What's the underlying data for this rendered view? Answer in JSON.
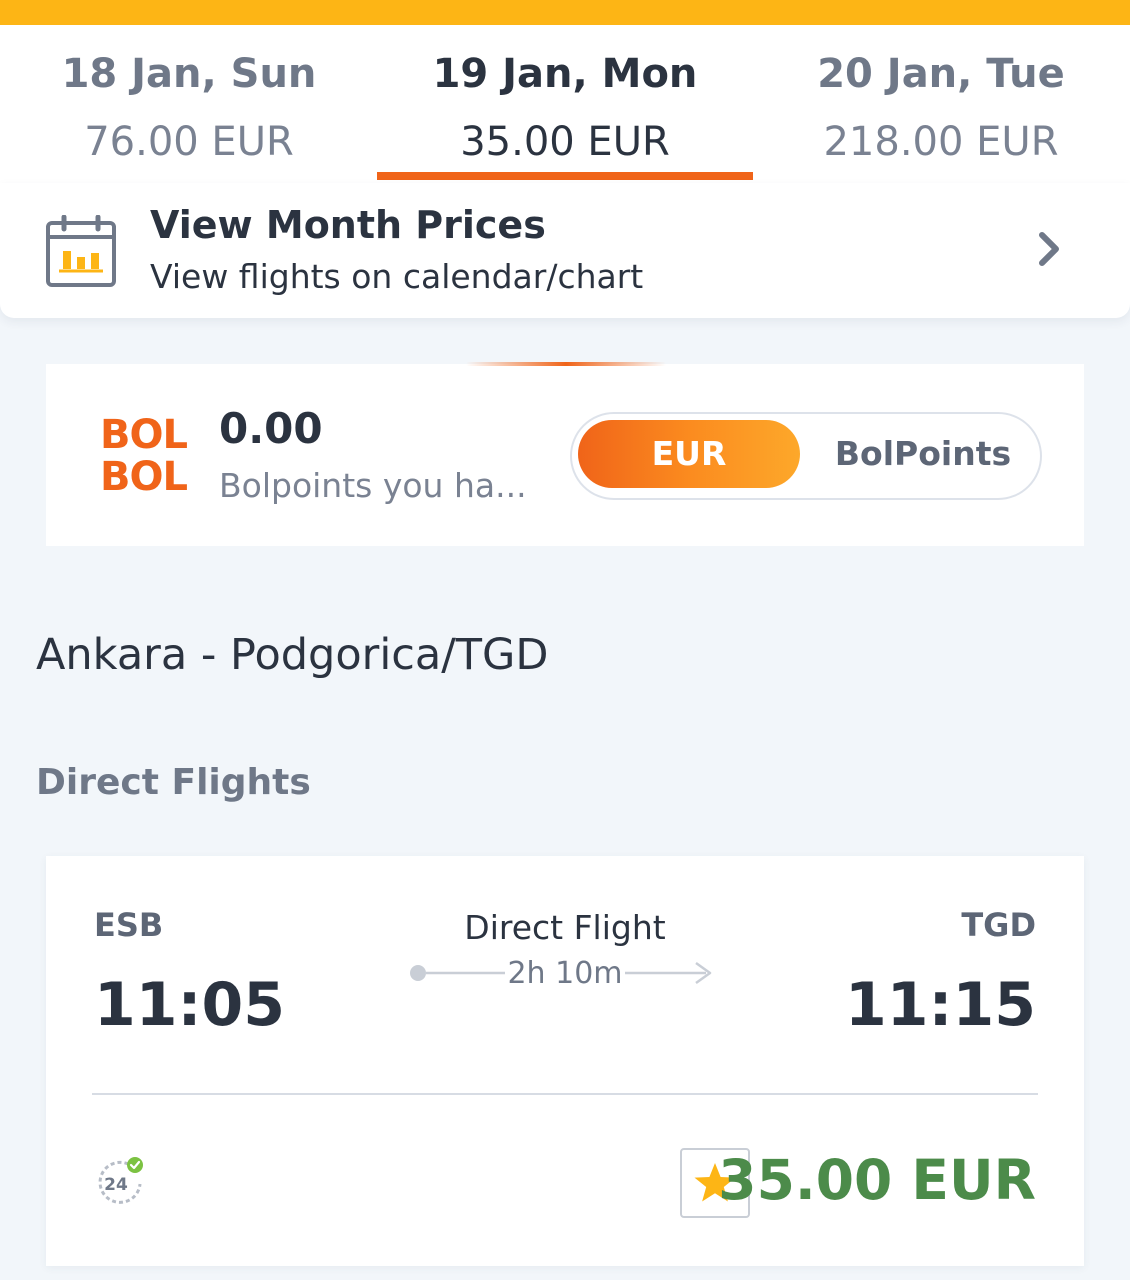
{
  "dates": [
    {
      "date": "18 Jan, Sun",
      "price": "76.00 EUR",
      "active": false
    },
    {
      "date": "19 Jan, Mon",
      "price": "35.00 EUR",
      "active": true
    },
    {
      "date": "20 Jan, Tue",
      "price": "218.00 EUR",
      "active": false
    }
  ],
  "month_prices": {
    "title": "View Month Prices",
    "subtitle": "View flights on calendar/chart",
    "icon": "calendar-chart-icon"
  },
  "bolpoints": {
    "logo_line1": "BOL",
    "logo_line2": "BOL",
    "value": "0.00",
    "subtitle": "Bolpoints you ha...",
    "toggle_options": [
      "EUR",
      "BolPoints"
    ],
    "selected": "EUR"
  },
  "route": {
    "title": "Ankara - Podgorica/TGD"
  },
  "section": {
    "title": "Direct Flights"
  },
  "flight": {
    "from_code": "ESB",
    "from_time": "11:05",
    "to_code": "TGD",
    "to_time": "11:15",
    "type": "Direct Flight",
    "duration": "2h 10m",
    "price": "35.00 EUR",
    "icons": [
      "24h-icon",
      "star-icon"
    ]
  },
  "colors": {
    "top_bar": "#fdb515",
    "accent": "#f06419",
    "price_green": "#4c8b4a",
    "background": "#f2f6fa"
  }
}
